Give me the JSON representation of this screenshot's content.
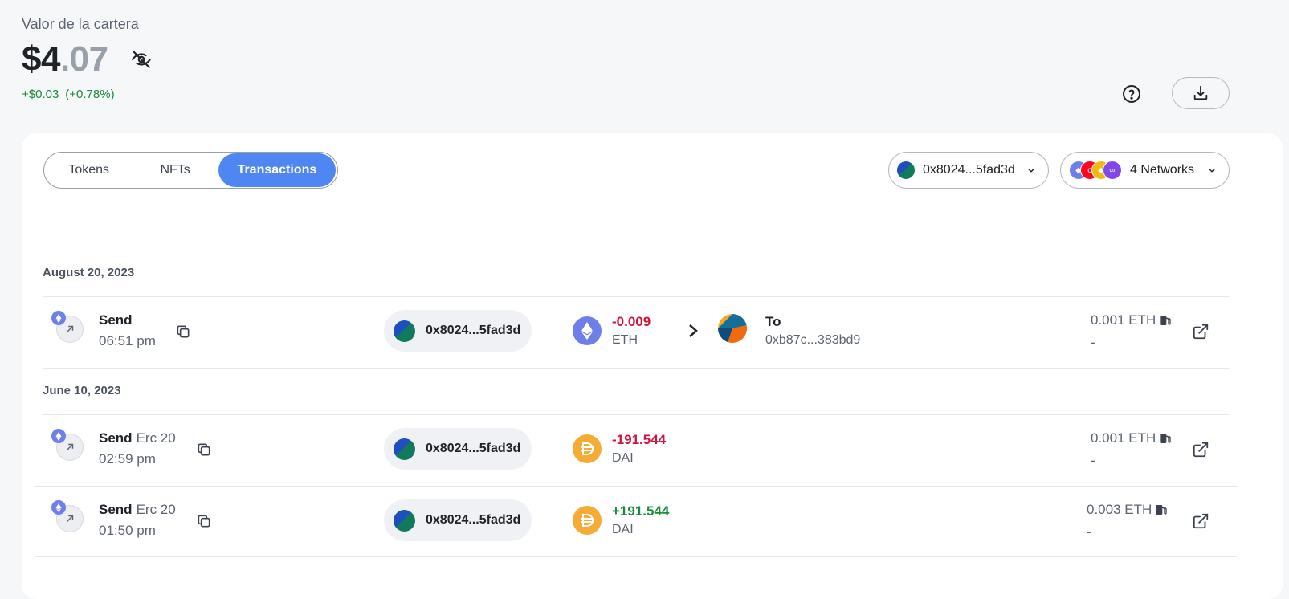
{
  "portfolio": {
    "label": "Valor de la cartera",
    "value_whole": "$4",
    "value_decimal": ".07",
    "change_amount": "+$0.03",
    "change_percent": "(+0.78%)"
  },
  "tabs": [
    {
      "label": "Tokens",
      "active": false
    },
    {
      "label": "NFTs",
      "active": false
    },
    {
      "label": "Transactions",
      "active": true
    }
  ],
  "account_selector": {
    "address": "0x8024...5fad3d"
  },
  "network_selector": {
    "label": "4 Networks",
    "icons": [
      "ethereum-icon",
      "optimism-icon",
      "bnb-icon",
      "polygon-icon"
    ]
  },
  "colors": {
    "accent": "#4f86f2",
    "negative": "#d3133c",
    "positive": "#1a8a3a",
    "eth": "#6e7fea",
    "dai": "#f5ac37"
  },
  "groups": [
    {
      "date": "August 20, 2023",
      "transactions": [
        {
          "type": "Send",
          "subtype": "",
          "time": "06:51 pm",
          "from": "0x8024...5fad3d",
          "amount": "-0.009",
          "symbol": "ETH",
          "to_label": "To",
          "to_address": "0xb87c...383bd9",
          "fee": "0.001 ETH",
          "fee_sub": "-"
        }
      ]
    },
    {
      "date": "June 10, 2023",
      "transactions": [
        {
          "type": "Send",
          "subtype": "Erc 20",
          "time": "02:59 pm",
          "from": "0x8024...5fad3d",
          "amount": "-191.544",
          "symbol": "DAI",
          "fee": "0.001 ETH",
          "fee_sub": "-"
        },
        {
          "type": "Send",
          "subtype": "Erc 20",
          "time": "01:50 pm",
          "from": "0x8024...5fad3d",
          "amount": "+191.544",
          "symbol": "DAI",
          "fee": "0.003 ETH",
          "fee_sub": "-"
        }
      ]
    }
  ]
}
